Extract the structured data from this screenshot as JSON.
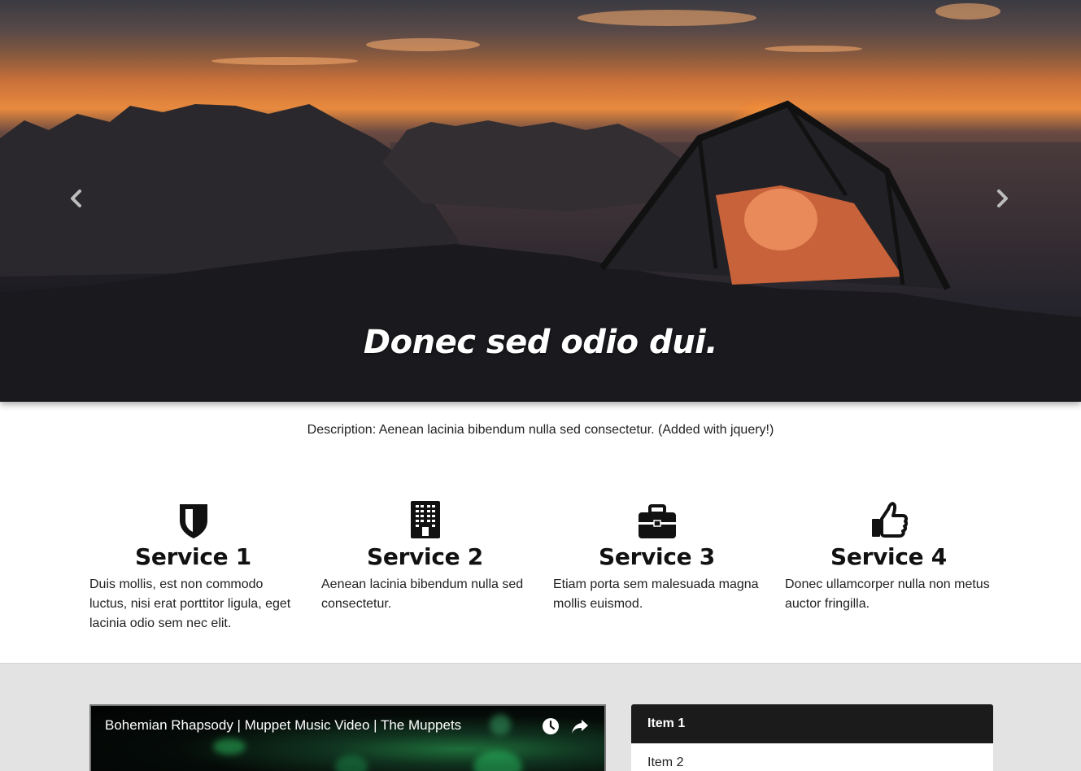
{
  "carousel": {
    "caption": "Donec sed odio dui.",
    "prev_icon": "chevron-left-icon",
    "next_icon": "chevron-right-icon"
  },
  "description": "Description: Aenean lacinia bibendum nulla sed consectetur. (Added with jquery!)",
  "services": [
    {
      "icon": "shield-icon",
      "title": "Service 1",
      "text": "Duis mollis, est non commodo luctus, nisi erat porttitor ligula, eget lacinia odio sem nec elit."
    },
    {
      "icon": "building-icon",
      "title": "Service 2",
      "text": "Aenean lacinia bibendum nulla sed consectetur."
    },
    {
      "icon": "briefcase-icon",
      "title": "Service 3",
      "text": "Etiam porta sem malesuada magna mollis euismod."
    },
    {
      "icon": "thumbs-up-icon",
      "title": "Service 4",
      "text": "Donec ullamcorper nulla non metus auctor fringilla."
    }
  ],
  "video": {
    "title": "Bohemian Rhapsody | Muppet Music Video | The Muppets",
    "icons": [
      "clock-icon",
      "share-icon"
    ]
  },
  "list": {
    "items": [
      "Item 1",
      "Item 2"
    ],
    "active_index": 0
  }
}
